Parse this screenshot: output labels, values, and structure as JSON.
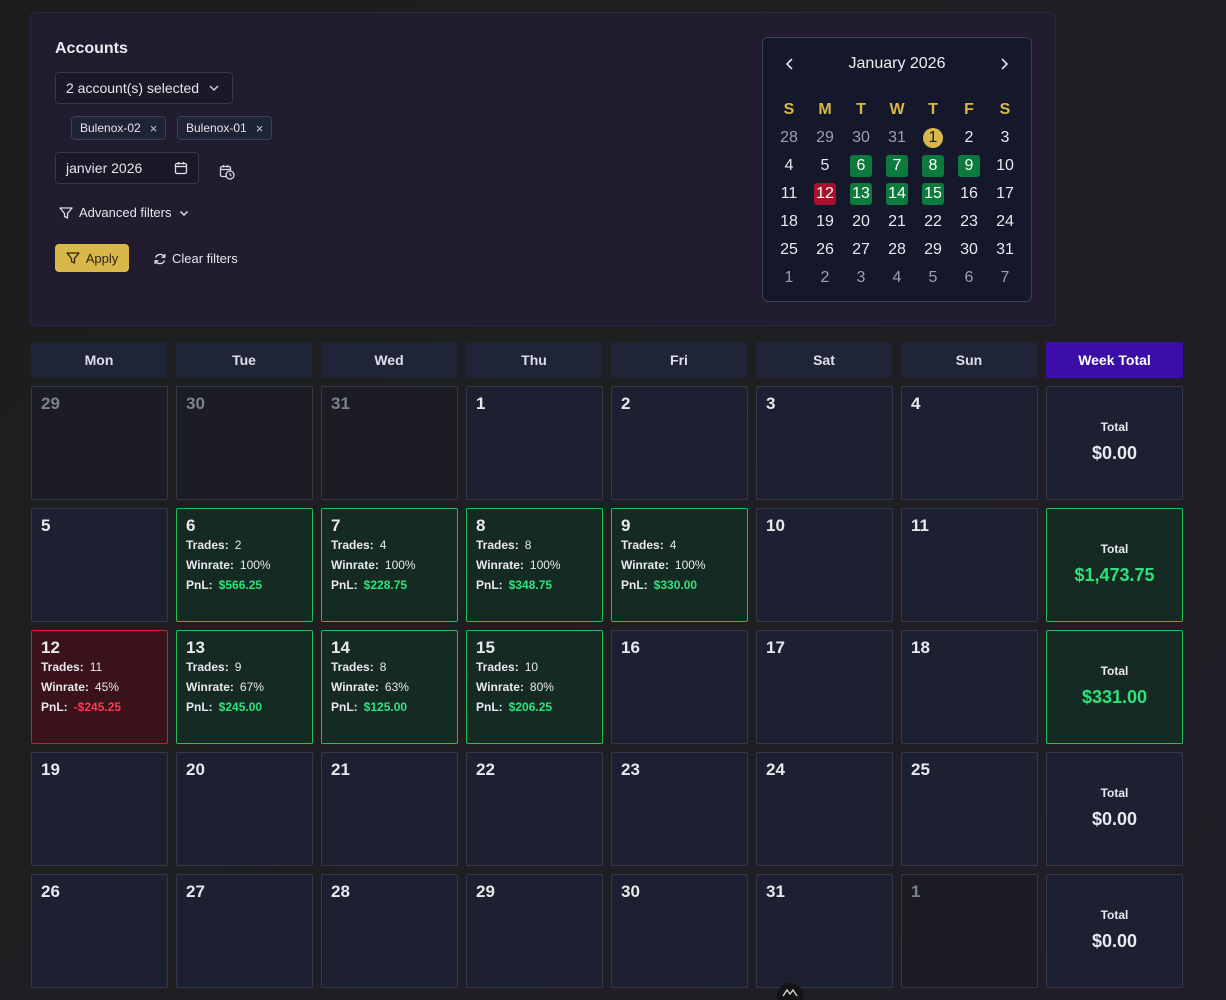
{
  "filters": {
    "accounts_title": "Accounts",
    "account_select_value": "2 account(s) selected",
    "chips": [
      "Bulenox-02",
      "Bulenox-01"
    ],
    "chip_remove": "×",
    "month_value": "janvier 2026",
    "advanced_filters_label": "Advanced filters",
    "apply_label": "Apply",
    "clear_label": "Clear filters"
  },
  "mini_calendar": {
    "title": "January 2026",
    "weekday_heads": [
      "S",
      "M",
      "T",
      "W",
      "T",
      "F",
      "S"
    ],
    "rows": [
      [
        {
          "d": "28",
          "s": "out"
        },
        {
          "d": "29",
          "s": "out"
        },
        {
          "d": "30",
          "s": "out"
        },
        {
          "d": "31",
          "s": "out"
        },
        {
          "d": "1",
          "s": "today"
        },
        {
          "d": "2",
          "s": "cur"
        },
        {
          "d": "3",
          "s": "cur"
        }
      ],
      [
        {
          "d": "4",
          "s": "cur"
        },
        {
          "d": "5",
          "s": "cur"
        },
        {
          "d": "6",
          "s": "win"
        },
        {
          "d": "7",
          "s": "win"
        },
        {
          "d": "8",
          "s": "win"
        },
        {
          "d": "9",
          "s": "win"
        },
        {
          "d": "10",
          "s": "cur"
        }
      ],
      [
        {
          "d": "11",
          "s": "cur"
        },
        {
          "d": "12",
          "s": "loss"
        },
        {
          "d": "13",
          "s": "win"
        },
        {
          "d": "14",
          "s": "win"
        },
        {
          "d": "15",
          "s": "win"
        },
        {
          "d": "16",
          "s": "cur"
        },
        {
          "d": "17",
          "s": "cur"
        }
      ],
      [
        {
          "d": "18",
          "s": "cur"
        },
        {
          "d": "19",
          "s": "cur"
        },
        {
          "d": "20",
          "s": "cur"
        },
        {
          "d": "21",
          "s": "cur"
        },
        {
          "d": "22",
          "s": "cur"
        },
        {
          "d": "23",
          "s": "cur"
        },
        {
          "d": "24",
          "s": "cur"
        }
      ],
      [
        {
          "d": "25",
          "s": "cur"
        },
        {
          "d": "26",
          "s": "cur"
        },
        {
          "d": "27",
          "s": "cur"
        },
        {
          "d": "28",
          "s": "cur"
        },
        {
          "d": "29",
          "s": "cur"
        },
        {
          "d": "30",
          "s": "cur"
        },
        {
          "d": "31",
          "s": "cur"
        }
      ],
      [
        {
          "d": "1",
          "s": "out"
        },
        {
          "d": "2",
          "s": "out"
        },
        {
          "d": "3",
          "s": "out"
        },
        {
          "d": "4",
          "s": "out"
        },
        {
          "d": "5",
          "s": "out"
        },
        {
          "d": "6",
          "s": "out"
        },
        {
          "d": "7",
          "s": "out"
        }
      ]
    ]
  },
  "calendar": {
    "headers": [
      "Mon",
      "Tue",
      "Wed",
      "Thu",
      "Fri",
      "Sat",
      "Sun",
      "Week Total"
    ],
    "stat_labels": {
      "trades": "Trades:",
      "winrate": "Winrate:",
      "pnl": "PnL:"
    },
    "total_label": "Total",
    "weeks": [
      {
        "days": [
          {
            "num": "29",
            "state": "out"
          },
          {
            "num": "30",
            "state": "out"
          },
          {
            "num": "31",
            "state": "out"
          },
          {
            "num": "1",
            "state": "none"
          },
          {
            "num": "2",
            "state": "none"
          },
          {
            "num": "3",
            "state": "none"
          },
          {
            "num": "4",
            "state": "none"
          }
        ],
        "total": "$0.00",
        "total_state": "none"
      },
      {
        "days": [
          {
            "num": "5",
            "state": "none"
          },
          {
            "num": "6",
            "state": "win",
            "trades": "2",
            "winrate": "100%",
            "pnl": "$566.25"
          },
          {
            "num": "7",
            "state": "win",
            "trades": "4",
            "winrate": "100%",
            "pnl": "$228.75"
          },
          {
            "num": "8",
            "state": "win",
            "trades": "8",
            "winrate": "100%",
            "pnl": "$348.75"
          },
          {
            "num": "9",
            "state": "win",
            "trades": "4",
            "winrate": "100%",
            "pnl": "$330.00"
          },
          {
            "num": "10",
            "state": "none"
          },
          {
            "num": "11",
            "state": "none"
          }
        ],
        "total": "$1,473.75",
        "total_state": "win"
      },
      {
        "days": [
          {
            "num": "12",
            "state": "loss",
            "trades": "11",
            "winrate": "45%",
            "pnl": "-$245.25"
          },
          {
            "num": "13",
            "state": "win",
            "trades": "9",
            "winrate": "67%",
            "pnl": "$245.00"
          },
          {
            "num": "14",
            "state": "win",
            "trades": "8",
            "winrate": "63%",
            "pnl": "$125.00"
          },
          {
            "num": "15",
            "state": "win",
            "trades": "10",
            "winrate": "80%",
            "pnl": "$206.25"
          },
          {
            "num": "16",
            "state": "none"
          },
          {
            "num": "17",
            "state": "none"
          },
          {
            "num": "18",
            "state": "none"
          }
        ],
        "total": "$331.00",
        "total_state": "win"
      },
      {
        "days": [
          {
            "num": "19",
            "state": "none"
          },
          {
            "num": "20",
            "state": "none"
          },
          {
            "num": "21",
            "state": "none"
          },
          {
            "num": "22",
            "state": "none"
          },
          {
            "num": "23",
            "state": "none"
          },
          {
            "num": "24",
            "state": "none"
          },
          {
            "num": "25",
            "state": "none"
          }
        ],
        "total": "$0.00",
        "total_state": "none"
      },
      {
        "days": [
          {
            "num": "26",
            "state": "none"
          },
          {
            "num": "27",
            "state": "none"
          },
          {
            "num": "28",
            "state": "none"
          },
          {
            "num": "29",
            "state": "none"
          },
          {
            "num": "30",
            "state": "none"
          },
          {
            "num": "31",
            "state": "none"
          },
          {
            "num": "1",
            "state": "out"
          }
        ],
        "total": "$0.00",
        "total_state": "none"
      }
    ]
  },
  "colors": {
    "accent_gold": "#d9b84a",
    "win_green": "#2ee37a",
    "loss_red": "#ff3b50",
    "week_header_purple": "#3b0ea8"
  }
}
